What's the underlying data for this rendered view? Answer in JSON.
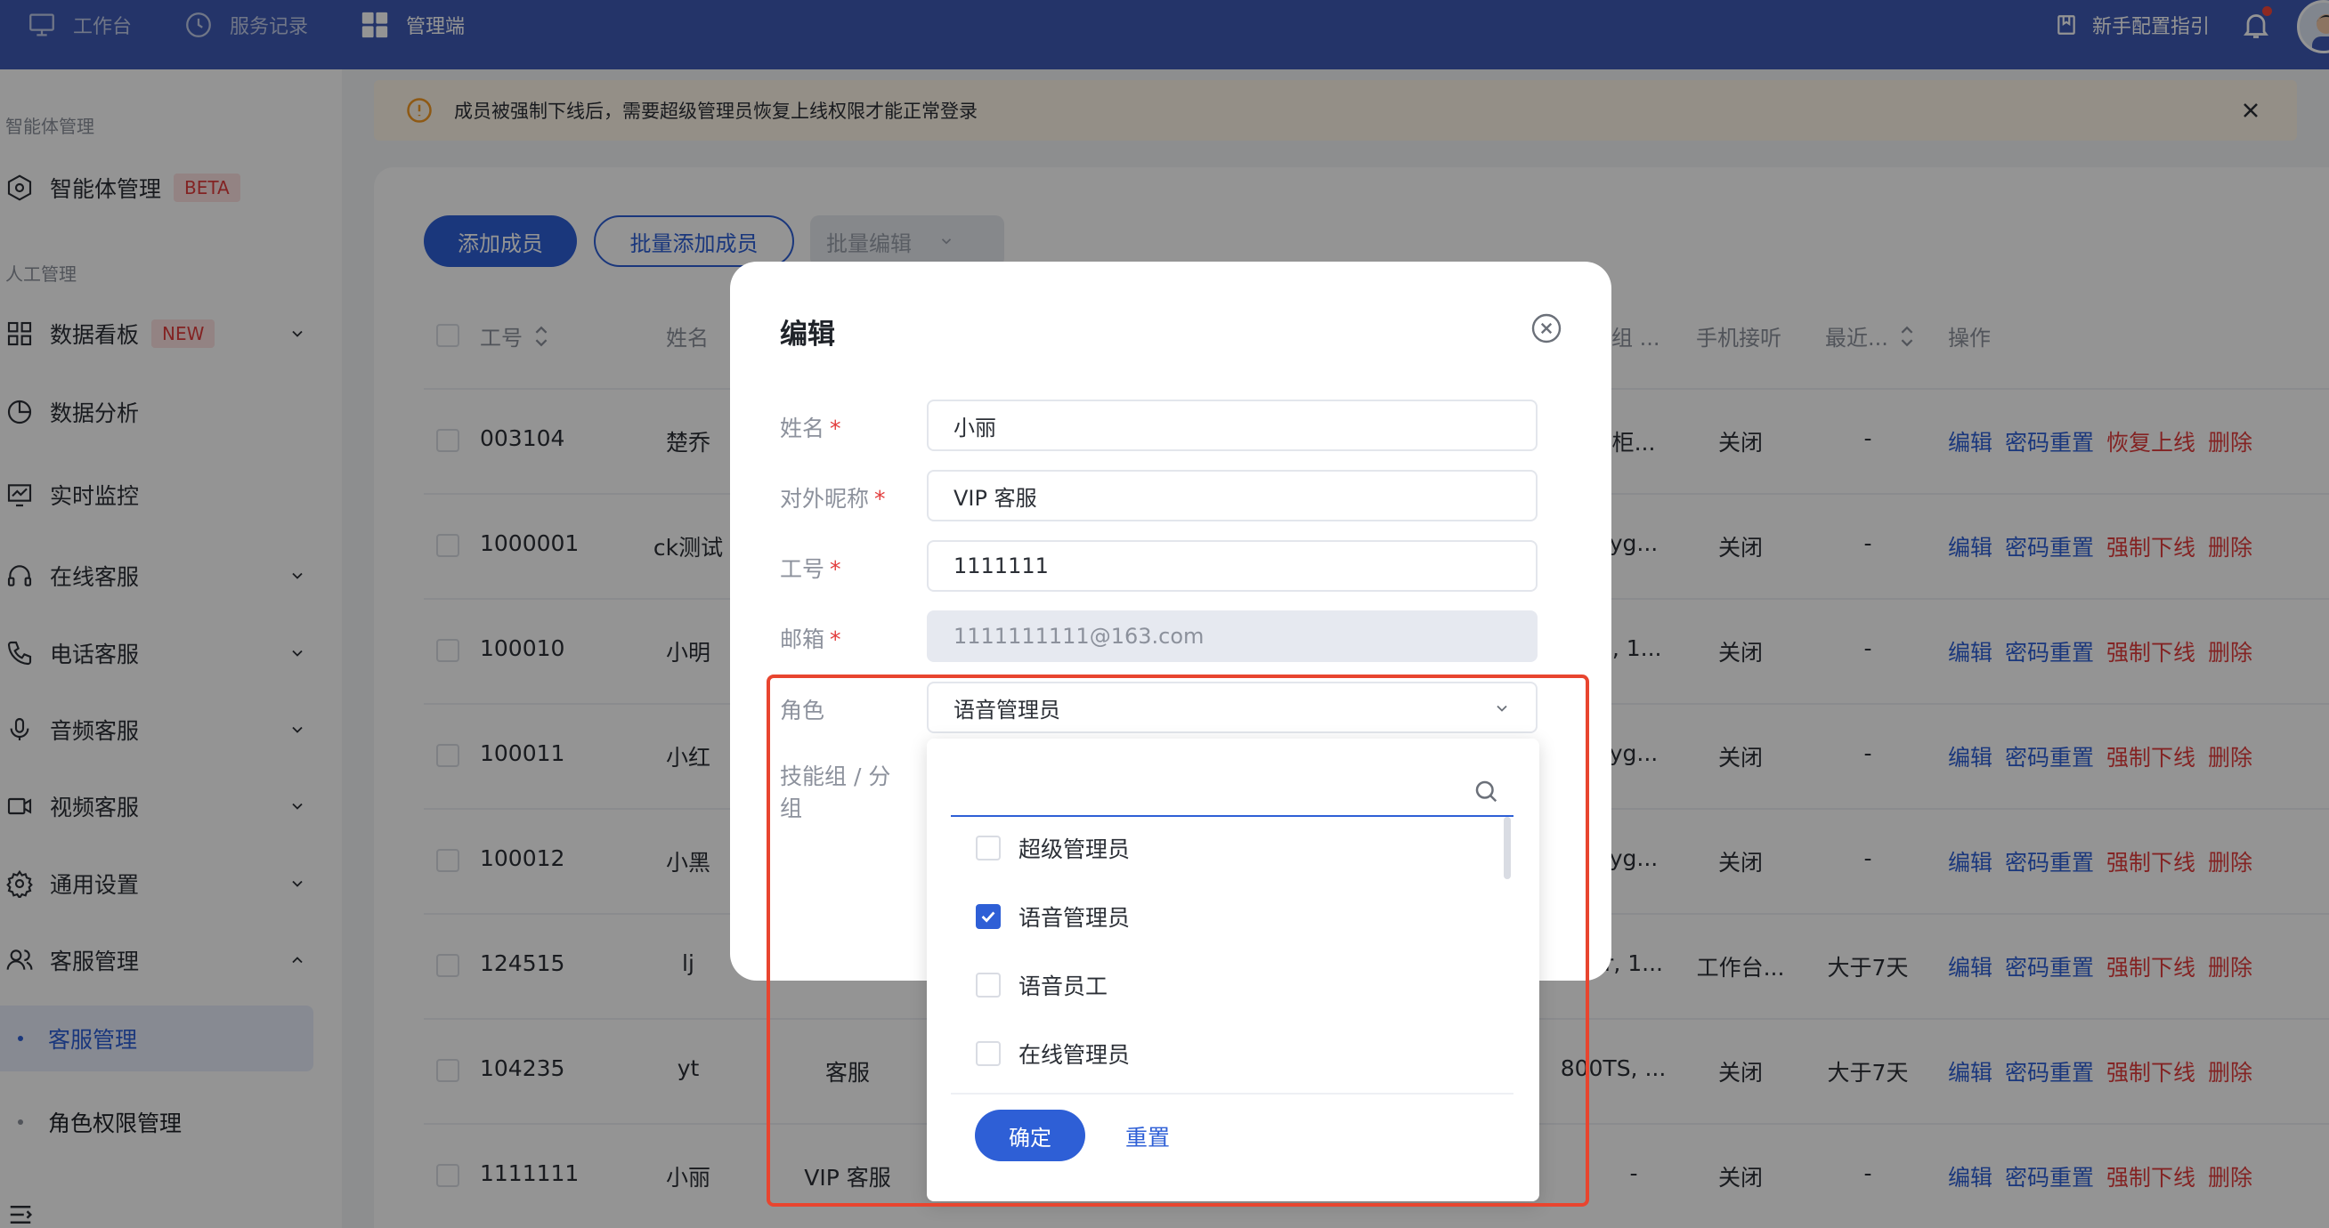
{
  "topbar": {
    "nav": [
      {
        "label": "工作台",
        "icon": "monitor-icon"
      },
      {
        "label": "服务记录",
        "icon": "clock-icon"
      },
      {
        "label": "管理端",
        "icon": "grid-icon"
      }
    ],
    "guide_label": "新手配置指引",
    "colors": {
      "bar": "#3e5bb6",
      "accent": "#2e5fd6",
      "danger": "#e23d3d"
    }
  },
  "sidebar": {
    "section_agent": "智能体管理",
    "agent_item": {
      "label": "智能体管理",
      "badge": "BETA"
    },
    "section_manual": "人工管理",
    "items": [
      {
        "label": "数据看板",
        "badge": "NEW"
      },
      {
        "label": "数据分析"
      },
      {
        "label": "实时监控"
      },
      {
        "label": "在线客服"
      },
      {
        "label": "电话客服"
      },
      {
        "label": "音频客服"
      },
      {
        "label": "视频客服"
      },
      {
        "label": "通用设置"
      },
      {
        "label": "客服管理"
      }
    ],
    "sub_items": [
      {
        "label": "客服管理",
        "active": true
      },
      {
        "label": "角色权限管理",
        "active": false
      }
    ]
  },
  "alert": {
    "text": "成员被强制下线后，需要超级管理员恢复上线权限才能正常登录"
  },
  "toolbar": {
    "add_member": "添加成员",
    "batch_add": "批量添加成员",
    "batch_edit": "批量编辑"
  },
  "table": {
    "headers": {
      "id": "工号",
      "name": "姓名",
      "group": "组 ...",
      "phone": "手机接听",
      "recent": "最近...",
      "ops": "操作"
    },
    "rows": [
      {
        "id": "003104",
        "name": "楚乔",
        "nick": "",
        "group": "柜...",
        "phone": "关闭",
        "recent": "-",
        "op3": "恢复上线"
      },
      {
        "id": "1000001",
        "name": "ck测试",
        "nick": "",
        "group": "yg...",
        "phone": "关闭",
        "recent": "-",
        "op3": "强制下线"
      },
      {
        "id": "100010",
        "name": "小明",
        "nick": "",
        "group": "I, 1...",
        "phone": "关闭",
        "recent": "-",
        "op3": "强制下线"
      },
      {
        "id": "100011",
        "name": "小红",
        "nick": "",
        "group": "yg...",
        "phone": "关闭",
        "recent": "-",
        "op3": "强制下线"
      },
      {
        "id": "100012",
        "name": "小黑",
        "nick": "",
        "group": "yg...",
        "phone": "关闭",
        "recent": "-",
        "op3": "强制下线"
      },
      {
        "id": "124515",
        "name": "lj",
        "nick": "",
        "group": "r, 1...",
        "phone": "工作台...",
        "recent": "大于7天",
        "op3": "强制下线"
      },
      {
        "id": "104235",
        "name": "yt",
        "nick": "客服",
        "group": "800TS, ...",
        "phone": "关闭",
        "recent": "大于7天",
        "op3": "强制下线"
      },
      {
        "id": "1111111",
        "name": "小丽",
        "nick": "VIP 客服",
        "group": "-",
        "phone": "关闭",
        "recent": "-",
        "op3": "强制下线"
      }
    ],
    "op_edit": "编辑",
    "op_reset": "密码重置",
    "op_delete": "删除"
  },
  "modal": {
    "title": "编辑",
    "fields": {
      "name": {
        "label": "姓名",
        "value": "小丽"
      },
      "nickname": {
        "label": "对外昵称",
        "value": "VIP 客服"
      },
      "id": {
        "label": "工号",
        "value": "1111111"
      },
      "email": {
        "label": "邮箱",
        "value": "1111111111@163.com"
      },
      "role": {
        "label": "角色",
        "value": "语音管理员"
      },
      "skill": {
        "label": "技能组 / 分组"
      }
    },
    "required_mark": "*",
    "dropdown": {
      "search_placeholder": "",
      "options": [
        {
          "label": "超级管理员",
          "checked": false
        },
        {
          "label": "语音管理员",
          "checked": true
        },
        {
          "label": "语音员工",
          "checked": false
        },
        {
          "label": "在线管理员",
          "checked": false
        }
      ],
      "confirm": "确定",
      "reset": "重置"
    }
  }
}
